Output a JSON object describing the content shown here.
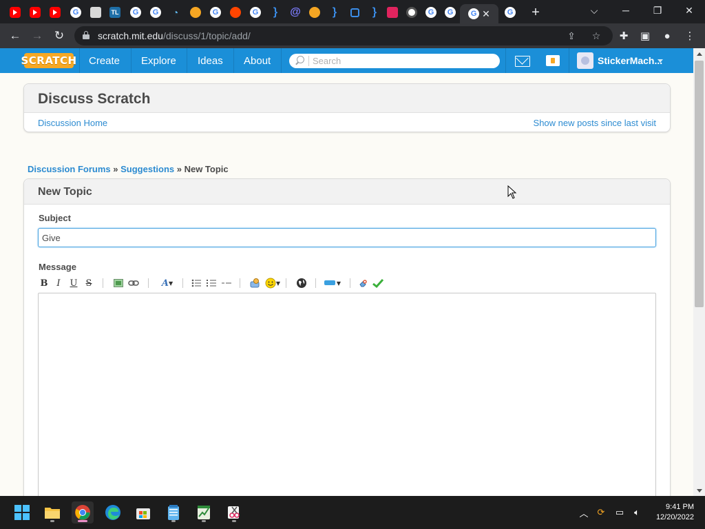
{
  "browser": {
    "tabs": [
      {
        "icon": "youtube-icon"
      },
      {
        "icon": "youtube-icon"
      },
      {
        "icon": "youtube-icon"
      },
      {
        "icon": "google-icon"
      },
      {
        "icon": "monitor-icon"
      },
      {
        "icon": "tl-icon",
        "label": "TL"
      },
      {
        "icon": "google-icon"
      },
      {
        "icon": "google-icon"
      },
      {
        "icon": "wifi-icon"
      },
      {
        "icon": "bookmark-icon"
      },
      {
        "icon": "google-icon"
      },
      {
        "icon": "reddit-icon"
      },
      {
        "icon": "google-icon"
      },
      {
        "icon": "brace-icon"
      },
      {
        "icon": "at-icon"
      },
      {
        "icon": "bookmark-icon"
      },
      {
        "icon": "brace-icon"
      },
      {
        "icon": "square-icon"
      },
      {
        "icon": "brace-icon"
      },
      {
        "icon": "roblox-icon"
      },
      {
        "icon": "chrome-icon"
      },
      {
        "icon": "google-icon"
      },
      {
        "icon": "google-icon"
      },
      {
        "icon": "google-icon",
        "active": true
      },
      {
        "icon": "google-icon"
      }
    ],
    "url_host": "scratch.mit.edu",
    "url_path": "/discuss/1/topic/add/"
  },
  "nav": {
    "logo": "SCRATCH",
    "links": [
      "Create",
      "Explore",
      "Ideas",
      "About"
    ],
    "search_placeholder": "Search",
    "username": "StickerMach..."
  },
  "discuss": {
    "title": "Discuss Scratch",
    "home_link": "Discussion Home",
    "new_posts_link": "Show new posts since last visit"
  },
  "breadcrumb": {
    "forums": "Discussion Forums",
    "sep1": " » ",
    "category": "Suggestions",
    "sep2": " » ",
    "current": "New Topic"
  },
  "topic": {
    "title": "New Topic",
    "subject_label": "Subject",
    "subject_value": "Give",
    "message_label": "Message",
    "message_value": ""
  },
  "editor_toolbar": {
    "bold": "B",
    "italic": "I",
    "underline": "U",
    "strike": "S"
  },
  "taskbar": {
    "time": "9:41 PM",
    "date": "12/20/2022"
  },
  "colors": {
    "scratch_blue": "#1b8fd8",
    "link": "#2c8bd1",
    "logo_orange": "#f7a824"
  }
}
